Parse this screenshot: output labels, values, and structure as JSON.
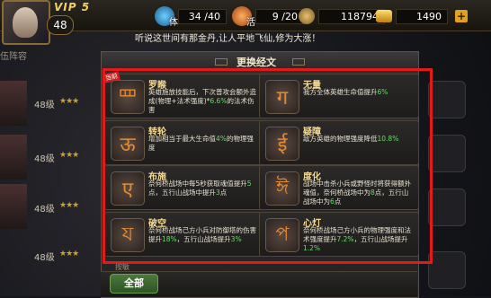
{
  "header": {
    "vip": "VIP 5",
    "level": "48",
    "stamina": {
      "value": "34 /40"
    },
    "energy": {
      "value": "9 /20"
    },
    "copper": {
      "value": "118794"
    },
    "gold": {
      "value": "1490"
    }
  },
  "marquee": "听说这世间有那金丹,让人平地飞仙,修为大涨！",
  "left_panel": {
    "title": "伍阵容",
    "levels": [
      "48级",
      "48级",
      "48级",
      "48级"
    ]
  },
  "modal": {
    "title": "更换经文",
    "cards": [
      {
        "name": "罗睺",
        "tag": "当前",
        "glyph": "罒",
        "desc_parts": [
          "英雄施放技能后，下次普攻会额外造成(物理+法术强度)*",
          "6.6%",
          "的法术伤害"
        ]
      },
      {
        "name": "无量",
        "glyph": "ग",
        "desc_parts": [
          "我方全体英雄生命值提升",
          "6%",
          ""
        ]
      },
      {
        "name": "转轮",
        "glyph": "ऊ",
        "desc_parts": [
          "增加相当于最大生命值",
          "4%",
          "的物理强度"
        ]
      },
      {
        "name": "疑障",
        "glyph": "ई",
        "desc_parts": [
          "敌方英雄的物理强度降低",
          "10.8%",
          ""
        ]
      },
      {
        "name": "布施",
        "glyph": "ए",
        "desc_parts": [
          "奈何桥战场中每5秒获取魂值提升",
          "5",
          "点，五行山战场中提升",
          "3",
          "点"
        ]
      },
      {
        "name": "度化",
        "glyph": "ঈ",
        "desc_parts": [
          "战场中击杀小兵或野怪时将获得额外魂值，奈何桥战场中为",
          "8",
          "点，五行山战场中为",
          "6",
          "点"
        ]
      },
      {
        "name": "破空",
        "glyph": "য",
        "desc_parts": [
          "奈何桥战场己方小兵对防御塔的伤害提升",
          "18%",
          "，五行山战场提升",
          "3%",
          ""
        ]
      },
      {
        "name": "心灯",
        "glyph": "প",
        "desc_parts": [
          "奈何桥战场己方小兵的物理强度和法术强度提升",
          "7.2%",
          "，五行山战场提升",
          "1.2%",
          ""
        ]
      }
    ],
    "partial_label": "按敏",
    "all_button": "全部"
  }
}
